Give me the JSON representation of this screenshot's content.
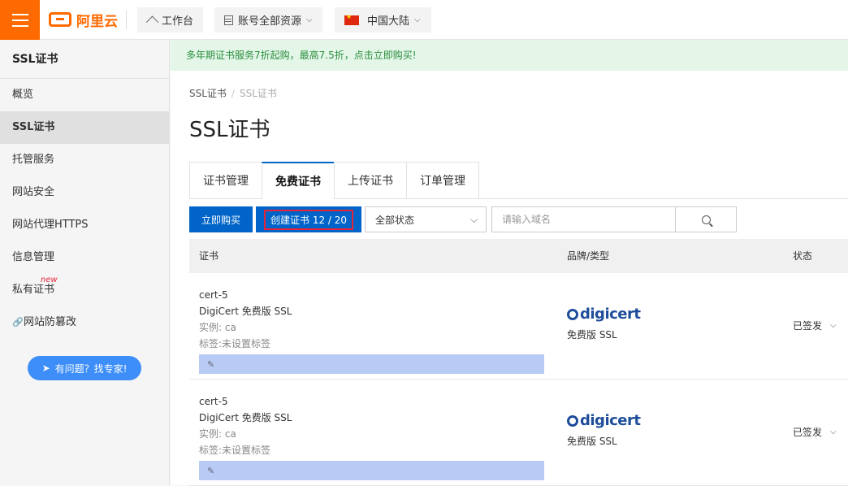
{
  "topbar": {
    "logo_text": "阿里云",
    "workbench": "工作台",
    "resources": "账号全部资源",
    "region": "中国大陆"
  },
  "sidebar": {
    "title": "SSL证书",
    "items": [
      {
        "label": "概览"
      },
      {
        "label": "SSL证书"
      },
      {
        "label": "托管服务"
      },
      {
        "label": "网站安全"
      },
      {
        "label": "网站代理HTTPS"
      },
      {
        "label": "信息管理"
      },
      {
        "label": "私有证书",
        "badge": "new"
      },
      {
        "label": "网站防篡改"
      }
    ],
    "help_button": "有问题？找专家!"
  },
  "banner": "多年期证书服务7折起购，最高7.5折，点击立即购买!",
  "breadcrumb": [
    "SSL证书",
    "SSL证书"
  ],
  "page_title": "SSL证书",
  "tabs": [
    {
      "label": "证书管理"
    },
    {
      "label": "免费证书"
    },
    {
      "label": "上传证书"
    },
    {
      "label": "订单管理"
    }
  ],
  "toolbar": {
    "buy_label": "立即购买",
    "create_label": "创建证书 12 / 20",
    "status_select": "全部状态",
    "search_placeholder": "请输入域名"
  },
  "table": {
    "headers": [
      "证书",
      "品牌/类型",
      "状态"
    ],
    "rows": [
      {
        "name": "cert-5",
        "type": "DigiCert 免费版 SSL",
        "instance": "实例: ca",
        "tag": "标签:未设置标签",
        "brand": "digicert",
        "brand_type": "免费版 SSL",
        "status": "已签发"
      },
      {
        "name": "cert-5",
        "type": "DigiCert 免费版 SSL",
        "instance": "实例: ca",
        "tag": "标签:未设置标签",
        "brand": "digicert",
        "brand_type": "免费版 SSL",
        "status": "已签发"
      }
    ]
  },
  "colors": {
    "brand_orange": "#ff6a00",
    "primary_blue": "#0064c8",
    "banner_green": "#2d8e3f"
  }
}
